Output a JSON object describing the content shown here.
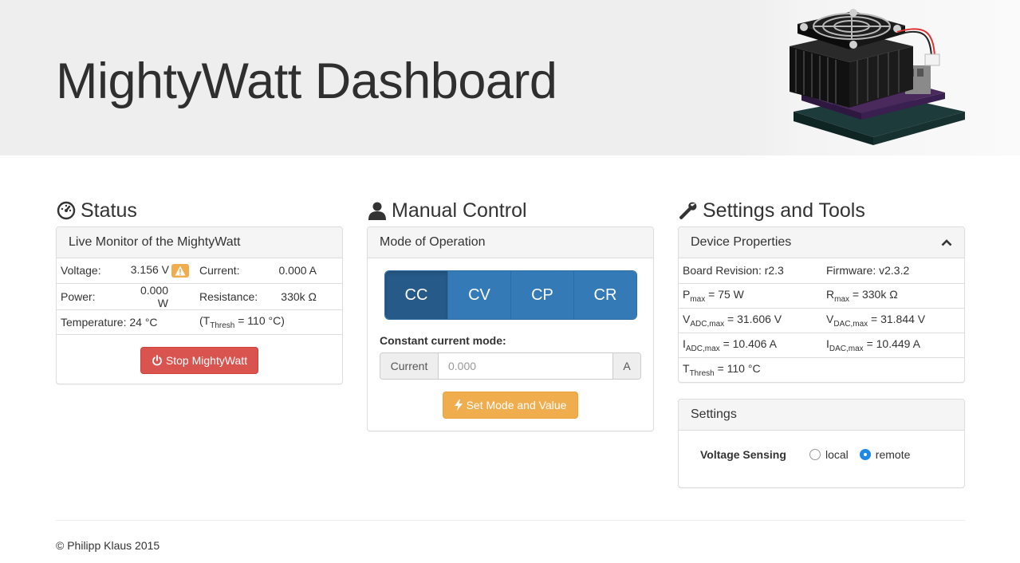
{
  "header": {
    "title": "MightyWatt Dashboard"
  },
  "status": {
    "title": "Status",
    "panel_title": "Live Monitor of the MightyWatt",
    "voltage_label": "Voltage:",
    "voltage_value": "3.156 V",
    "current_label": "Current:",
    "current_value": "0.000 A",
    "power_label": "Power:",
    "power_value": "0.000 W",
    "resistance_label": "Resistance:",
    "resistance_value": "330k Ω",
    "temperature_text": "Temperature: 24 °C",
    "thresh_prefix": "(T",
    "thresh_sub": "Thresh",
    "thresh_suffix": " = 110 °C)",
    "stop_button": "Stop MightyWatt"
  },
  "manual": {
    "title": "Manual Control",
    "panel_title": "Mode of Operation",
    "modes": [
      "CC",
      "CV",
      "CP",
      "CR"
    ],
    "selected_mode": "CC",
    "mode_label": "Constant current mode:",
    "input_addon": "Current",
    "input_placeholder": "0.000",
    "input_unit": "A",
    "set_button": "Set Mode and Value"
  },
  "settings": {
    "title": "Settings and Tools",
    "device_panel_title": "Device Properties",
    "board_revision": "Board Revision: r2.3",
    "firmware": "Firmware: v2.3.2",
    "pmax_base": "P",
    "pmax_sub": "max",
    "pmax_val": " = 75 W",
    "rmax_base": "R",
    "rmax_sub": "max",
    "rmax_val": " = 330k Ω",
    "vadc_base": "V",
    "vadc_sub": "ADC,max",
    "vadc_val": " = 31.606 V",
    "vdac_base": "V",
    "vdac_sub": "DAC,max",
    "vdac_val": " = 31.844 V",
    "iadc_base": "I",
    "iadc_sub": "ADC,max",
    "iadc_val": " = 10.406 A",
    "idac_base": "I",
    "idac_sub": "DAC,max",
    "idac_val": " = 10.449 A",
    "tthresh_base": "T",
    "tthresh_sub": "Thresh",
    "tthresh_val": " = 110 °C",
    "settings_panel_title": "Settings",
    "voltage_sensing_label": "Voltage Sensing",
    "option_local": "local",
    "option_remote": "remote",
    "selected_sensing": "remote"
  },
  "footer": {
    "copyright": "© Philipp Klaus 2015"
  },
  "colors": {
    "primary": "#337ab7",
    "danger": "#d9534f",
    "warning": "#f0ad4e"
  }
}
